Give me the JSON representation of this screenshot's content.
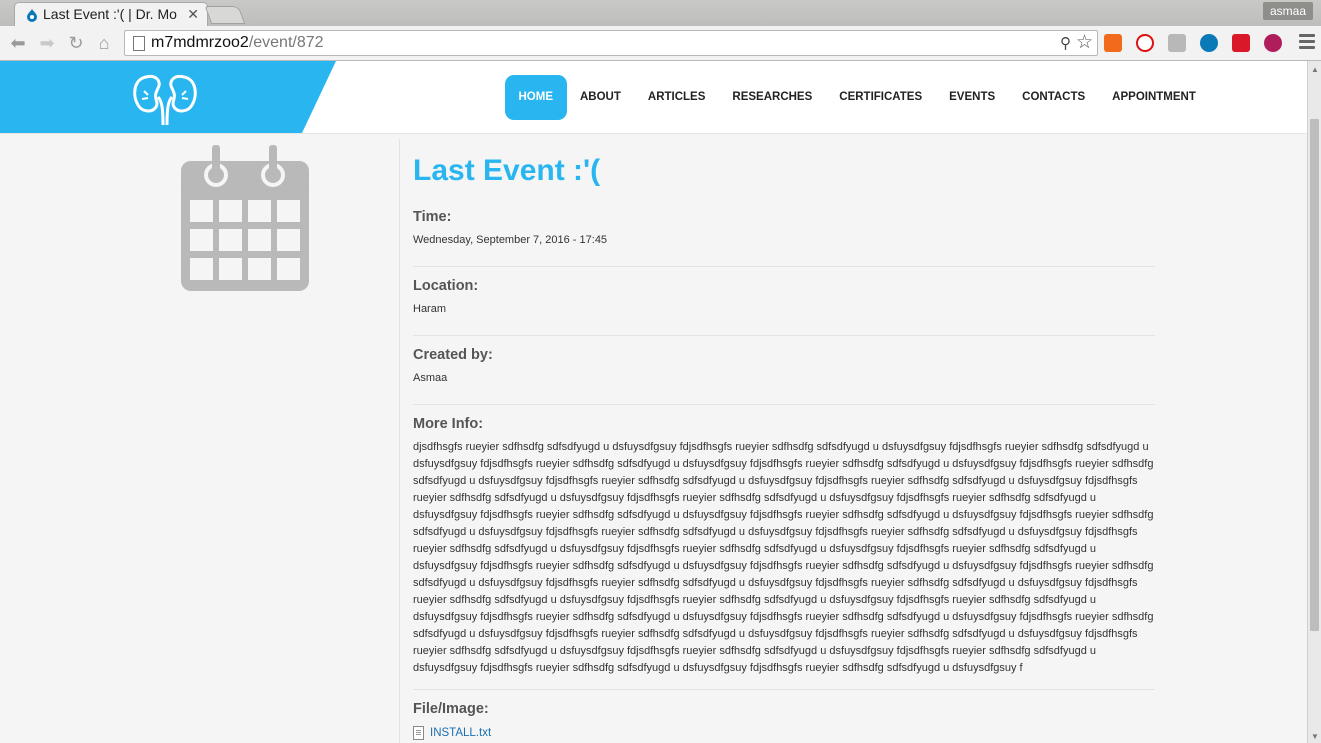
{
  "browser": {
    "tab_title": "Last Event :'( | Dr. Mo",
    "url_host": "m7mdmrzoo2",
    "url_path": "/event/872",
    "user": "asmaa"
  },
  "nav": {
    "items": [
      {
        "label": "HOME",
        "active": true
      },
      {
        "label": "ABOUT"
      },
      {
        "label": "ARTICLES"
      },
      {
        "label": "RESEARCHES"
      },
      {
        "label": "CERTIFICATES"
      },
      {
        "label": "EVENTS"
      },
      {
        "label": "CONTACTS"
      },
      {
        "label": "APPOINTMENT"
      }
    ]
  },
  "event": {
    "title": "Last Event :'(",
    "time_label": "Time:",
    "time_value": "Wednesday, September 7, 2016 - 17:45",
    "location_label": "Location:",
    "location_value": "Haram",
    "created_label": "Created by:",
    "created_value": "Asmaa",
    "more_label": "More Info:",
    "more_value": "djsdfhsgfs rueyier sdfhsdfg sdfsdfyugd u dsfuysdfgsuy fdjsdfhsgfs rueyier sdfhsdfg sdfsdfyugd u dsfuysdfgsuy fdjsdfhsgfs rueyier sdfhsdfg sdfsdfyugd u dsfuysdfgsuy fdjsdfhsgfs rueyier sdfhsdfg sdfsdfyugd u dsfuysdfgsuy fdjsdfhsgfs rueyier sdfhsdfg sdfsdfyugd u dsfuysdfgsuy fdjsdfhsgfs rueyier sdfhsdfg sdfsdfyugd u dsfuysdfgsuy fdjsdfhsgfs rueyier sdfhsdfg sdfsdfyugd u dsfuysdfgsuy fdjsdfhsgfs rueyier sdfhsdfg sdfsdfyugd u dsfuysdfgsuy fdjsdfhsgfs rueyier sdfhsdfg sdfsdfyugd u dsfuysdfgsuy fdjsdfhsgfs rueyier sdfhsdfg sdfsdfyugd u dsfuysdfgsuy fdjsdfhsgfs rueyier sdfhsdfg sdfsdfyugd u dsfuysdfgsuy fdjsdfhsgfs rueyier sdfhsdfg sdfsdfyugd u dsfuysdfgsuy fdjsdfhsgfs rueyier sdfhsdfg sdfsdfyugd u dsfuysdfgsuy fdjsdfhsgfs rueyier sdfhsdfg sdfsdfyugd u dsfuysdfgsuy fdjsdfhsgfs rueyier sdfhsdfg sdfsdfyugd u dsfuysdfgsuy fdjsdfhsgfs rueyier sdfhsdfg sdfsdfyugd u dsfuysdfgsuy fdjsdfhsgfs rueyier sdfhsdfg sdfsdfyugd u dsfuysdfgsuy fdjsdfhsgfs rueyier sdfhsdfg sdfsdfyugd u dsfuysdfgsuy fdjsdfhsgfs rueyier sdfhsdfg sdfsdfyugd u dsfuysdfgsuy fdjsdfhsgfs rueyier sdfhsdfg sdfsdfyugd u dsfuysdfgsuy fdjsdfhsgfs rueyier sdfhsdfg sdfsdfyugd u dsfuysdfgsuy fdjsdfhsgfs rueyier sdfhsdfg sdfsdfyugd u dsfuysdfgsuy fdjsdfhsgfs rueyier sdfhsdfg sdfsdfyugd u dsfuysdfgsuy fdjsdfhsgfs rueyier sdfhsdfg sdfsdfyugd u dsfuysdfgsuy fdjsdfhsgfs rueyier sdfhsdfg sdfsdfyugd u dsfuysdfgsuy fdjsdfhsgfs rueyier sdfhsdfg sdfsdfyugd u dsfuysdfgsuy fdjsdfhsgfs rueyier sdfhsdfg sdfsdfyugd u dsfuysdfgsuy fdjsdfhsgfs rueyier sdfhsdfg sdfsdfyugd u dsfuysdfgsuy fdjsdfhsgfs rueyier sdfhsdfg sdfsdfyugd u dsfuysdfgsuy fdjsdfhsgfs rueyier sdfhsdfg sdfsdfyugd u dsfuysdfgsuy fdjsdfhsgfs rueyier sdfhsdfg sdfsdfyugd u dsfuysdfgsuy fdjsdfhsgfs rueyier sdfhsdfg sdfsdfyugd u dsfuysdfgsuy fdjsdfhsgfs rueyier sdfhsdfg sdfsdfyugd u dsfuysdfgsuy fdjsdfhsgfs rueyier sdfhsdfg sdfsdfyugd u dsfuysdfgsuy fdjsdfhsgfs rueyier sdfhsdfg sdfsdfyugd u dsfuysdfgsuy fdjsdfhsgfs rueyier sdfhsdfg sdfsdfyugd u dsfuysdfgsuy fdjsdfhsgfs rueyier sdfhsdfg sdfsdfyugd u dsfuysdfgsuy f",
    "file_label": "File/Image:",
    "file_name": "INSTALL.txt"
  },
  "colors": {
    "accent": "#29b6f0"
  }
}
